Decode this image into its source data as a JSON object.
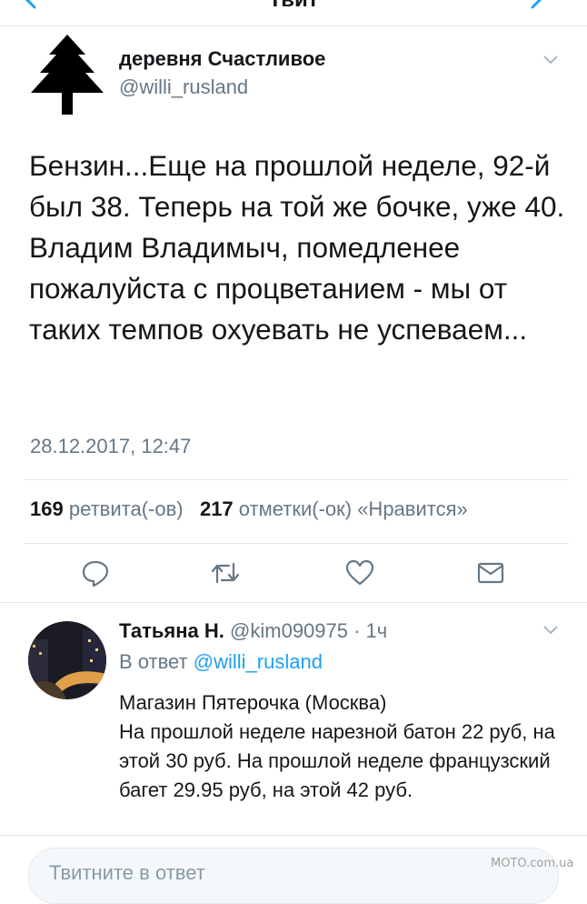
{
  "header": {
    "title": "Твит",
    "back_icon": "chevron-left-icon",
    "forward_icon": "chevron-right-icon"
  },
  "tweet": {
    "avatar_icon": "fir-tree-icon",
    "author_name": "деревня Счастливое",
    "author_handle": "@willi_rusland",
    "text": "Бензин...Еще на прошлой неделе, 92-й был 38. Теперь на той же бочке, уже 40. Владим Владимыч, помедленее пожалуйста с процветанием -  мы от таких темпов охуевать не успеваем...",
    "timestamp": "28.12.2017, 12:47",
    "retweets_count": "169",
    "retweets_label": "ретвита(-ов)",
    "likes_count": "217",
    "likes_label": "отметки(-ок) «Нравится»"
  },
  "actions": [
    "reply-icon",
    "retweet-icon",
    "heart-icon",
    "share-icon"
  ],
  "reply": {
    "author_name": "Татьяна Н.",
    "meta": "@kim090975 · 1ч",
    "in_reply_prefix": "В ответ",
    "in_reply_handle": "@willi_rusland",
    "text": "Магазин Пятерочка (Москва)\nНа прошлой неделе нарезной батон 22 руб, на этой 30 руб. На прошлой неделе  французский багет 29.95 руб, на этой 42 руб."
  },
  "composer": {
    "placeholder": "Твитните в ответ"
  },
  "watermark": "MOTO.com.ua",
  "colors": {
    "accent": "#1da1f2",
    "secondary_text": "#657786",
    "divider": "#e1e8ed"
  }
}
